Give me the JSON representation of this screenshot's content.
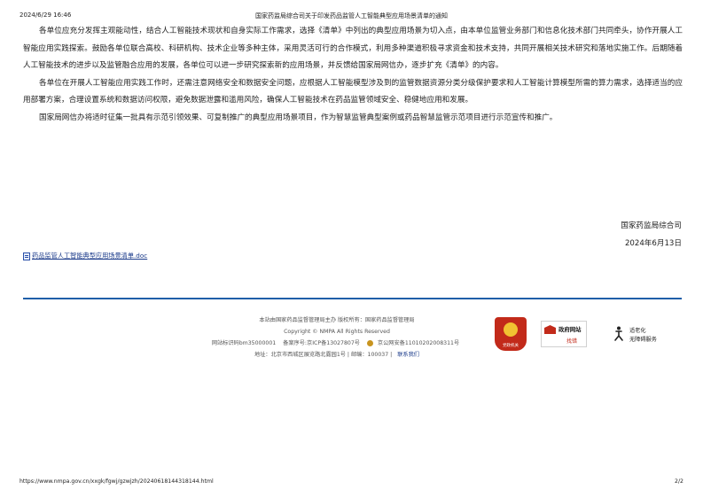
{
  "print_header": {
    "datetime": "2024/6/29 16:46",
    "page_title": "国家药监局综合司关于印发药品监管人工智能典型应用场景清单的通知"
  },
  "article": {
    "paragraphs": [
      "各单位应充分发挥主观能动性，结合人工智能技术现状和自身实际工作需求，选择《清单》中列出的典型应用场景为切入点，由本单位监管业务部门和信息化技术部门共同牵头，协作开展人工智能应用实践探索。鼓励各单位联合高校、科研机构、技术企业等多种主体，采用灵活可行的合作模式，利用多种渠道积极寻求资金和技术支持，共同开展相关技术研究和落地实施工作。后期随着人工智能技术的进步以及监管融合应用的发展，各单位可以进一步研究探索新的应用场景，并反馈给国家局网信办，逐步扩充《清单》的内容。",
      "各单位在开展人工智能应用实践工作时，还需注意网络安全和数据安全问题，应根据人工智能模型涉及到的监管数据资源分类分级保护要求和人工智能计算模型所需的算力需求，选择适当的应用部署方案，合理设置系统和数据访问权限，避免数据泄露和滥用风险，确保人工智能技术在药品监管领域安全、稳健地应用和发展。",
      "国家局网信办将适时征集一批具有示范引领效果、可复制推广的典型应用场景项目，作为智慧监管典型案例或药品智慧监管示范项目进行示范宣传和推广。"
    ],
    "signoff_org": "国家药监局综合司",
    "signoff_date": "2024年6月13日",
    "attachment_label": "药品监管人工智能典型应用场景清单.doc",
    "attachment_icon": "doc-file-icon"
  },
  "footer": {
    "sponsor": "本站由国家药品监督管理局主办 版权所有：国家药品监督管理局",
    "copyright": "Copyright © NMPA All Rights Reserved",
    "site_id": "网站标识码bm35000001",
    "icp": "备案序号:京ICP备13027807号",
    "police": "京公网安备11010202008311号",
    "address": "地址：北京市西城区展览路北露园1号 | 邮编：100037 |",
    "contact_link": "联系我们",
    "badge_text": "党政机关",
    "gov_link_line1": "政府网站",
    "gov_link_line2": "找错",
    "access_line1": "适老化",
    "access_line2": "无障碍服务",
    "accent_color": "#1f5fa8",
    "badge_color": "#c22a1a"
  },
  "print_footer": {
    "url": "https://www.nmpa.gov.cn/xxgk/fgwj/gzwjzh/20240618144318144.html",
    "page_number": "2/2"
  }
}
